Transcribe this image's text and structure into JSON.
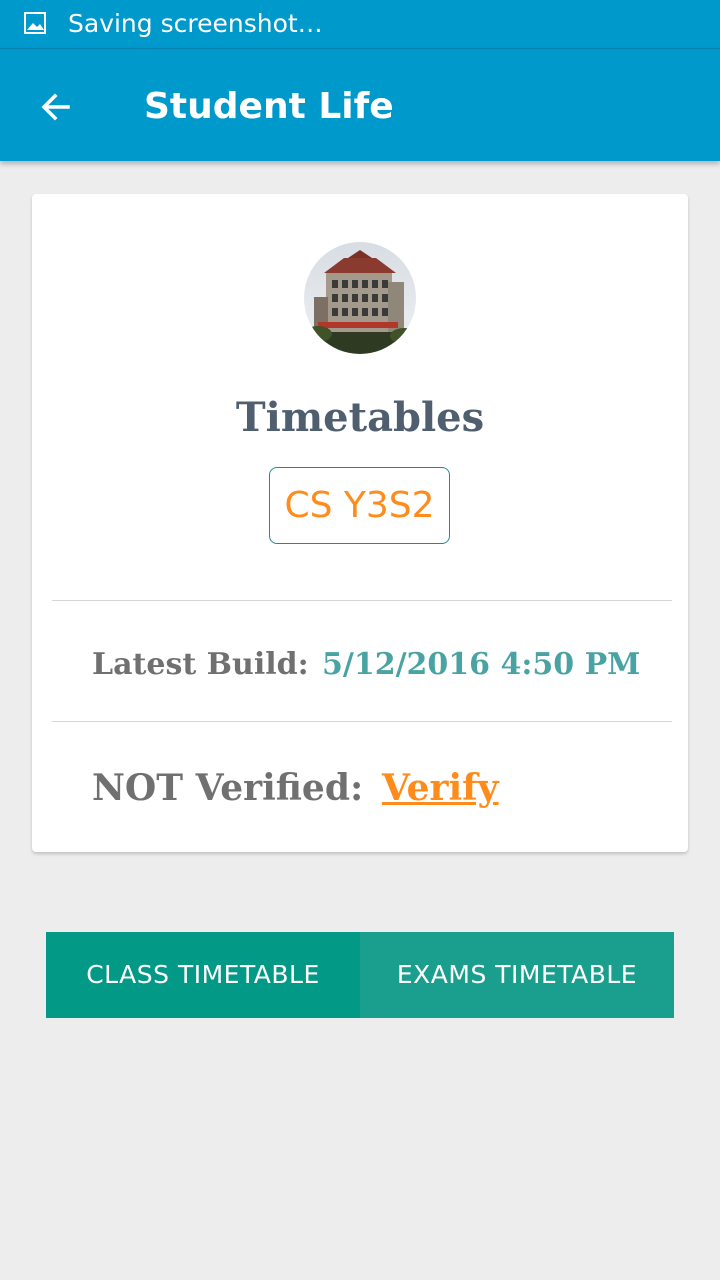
{
  "status_bar": {
    "icon": "image-icon",
    "text": "Saving screenshot…"
  },
  "app_bar": {
    "back_icon": "arrow-left-icon",
    "title": "Student Life"
  },
  "card": {
    "avatar": "university-building-photo",
    "title": "Timetables",
    "course_badge": "CS Y3S2",
    "build_label": "Latest Build:",
    "build_value": "5/12/2016 4:50 PM",
    "verify_label": "NOT Verified:",
    "verify_link": "Verify"
  },
  "buttons": {
    "class_timetable": "CLASS TIMETABLE",
    "exams_timetable": "EXAMS TIMETABLE"
  },
  "colors": {
    "primary": "#0099cc",
    "accent": "#ff8c1a",
    "teal": "#029a87",
    "teal_text": "#4aa3a3"
  }
}
